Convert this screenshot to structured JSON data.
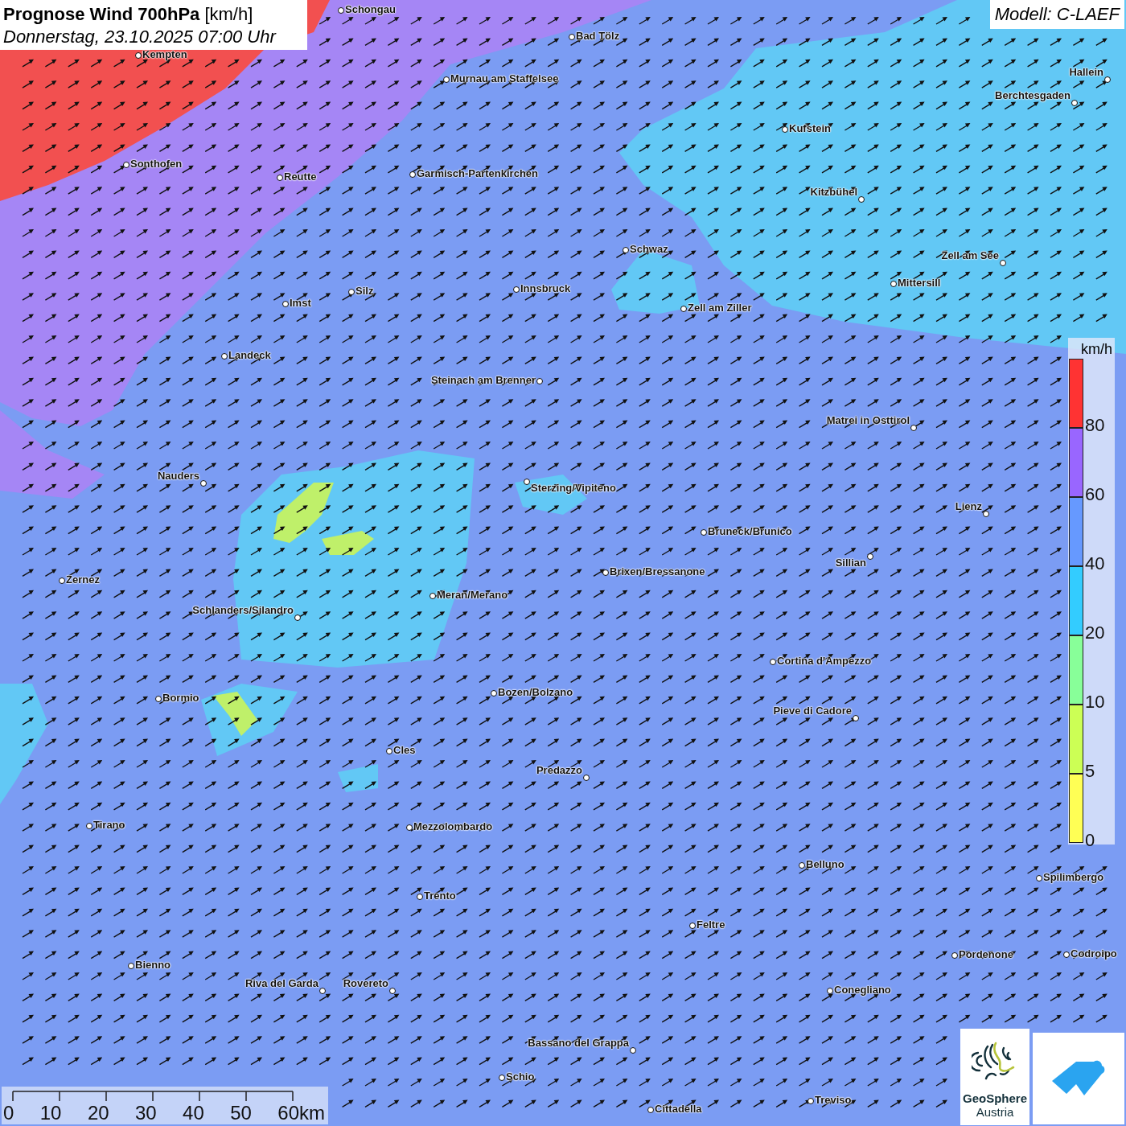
{
  "title": {
    "heading": "**Prognose Wind 700hPa** [km/h]",
    "date": "Donnerstag, 23.10.2025 07:00 Uhr"
  },
  "model": "Modell: C-LAEF",
  "cities": [
    "Schongau",
    "Bad Tölz",
    "Kempten",
    "Murnau am Staffelsee",
    "Hallein",
    "Berchtesgaden",
    "Kufstein",
    "Sonthofen",
    "Reutte",
    "Garmisch-Partenkirchen",
    "Kitzbühel",
    "Schwaz",
    "Zell am See",
    "Mittersill",
    "Innsbruck",
    "Silz",
    "Imst",
    "Zell am Ziller",
    "Landeck",
    "Steinach am Brenner",
    "Matrei in Osttirol",
    "Nauders",
    "Sterzing/Vipiteno",
    "Lienz",
    "Bruneck/Brunico",
    "Sillian",
    "Brixen/Bressanone",
    "Zernez",
    "Meran/Merano",
    "Schlanders/Silandro",
    "Cortina d'Ampezzo",
    "Bozen/Bolzano",
    "Bormio",
    "Pieve di Cadore",
    "Cles",
    "Predazzo",
    "Tirano",
    "Mezzolombardo",
    "Belluno",
    "Spilimbergo",
    "Trento",
    "Feltre",
    "Bienno",
    "Pordenone",
    "Codroipo",
    "Riva del Garda",
    "Rovereto",
    "Conegliano",
    "Bassano del Grappa",
    "Schio",
    "Treviso",
    "Cittadella"
  ],
  "legend": {
    "unit": "km/h",
    "items": [
      {
        "label": "80",
        "color": "#ff3333"
      },
      {
        "label": "60",
        "color": "#9966ff"
      },
      {
        "label": "40",
        "color": "#6699ff"
      },
      {
        "label": "20",
        "color": "#33ccff"
      },
      {
        "label": "10",
        "color": "#88ff99"
      },
      {
        "label": "5",
        "color": "#ccff55"
      },
      {
        "label": "0",
        "color": "#ffff55"
      }
    ]
  },
  "scale": {
    "labels": [
      "0",
      "10",
      "20",
      "30",
      "40",
      "50",
      "60km"
    ]
  },
  "logos": {
    "brand_name": "GeoSphere",
    "brand_sub": "Austria"
  }
}
